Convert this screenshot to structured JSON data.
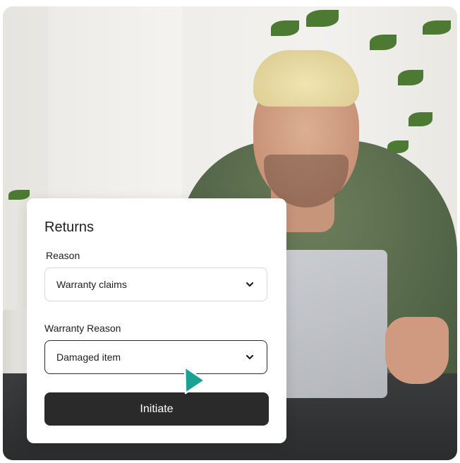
{
  "card": {
    "title": "Returns",
    "reason_label": "Reason",
    "reason_value": "Warranty claims",
    "warranty_label": "Warranty Reason",
    "warranty_value": "Damaged item",
    "submit_label": "Initiate"
  },
  "colors": {
    "button_bg": "#2a2a2a",
    "cursor": "#1aa393",
    "card_bg": "#ffffff"
  },
  "icons": {
    "select_chevron": "chevron-down-icon",
    "pointer": "pointer-cursor-icon"
  }
}
